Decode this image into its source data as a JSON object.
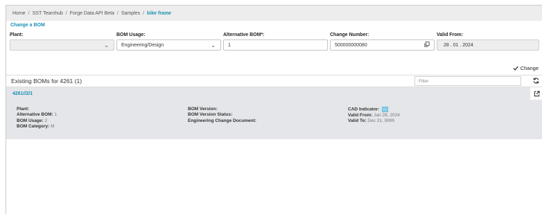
{
  "breadcrumb": {
    "items": [
      "Home",
      "SST Teamhub",
      "Forge Data API Beta",
      "Samples"
    ],
    "separator": "/",
    "current": "bike frame"
  },
  "form": {
    "heading": "Change a BOM",
    "plant": {
      "label": "Plant:",
      "value": ""
    },
    "bom_usage": {
      "label": "BOM Usage:",
      "value": "Engineering/Design"
    },
    "alternative_bom": {
      "label": "Alternative BOM*:",
      "value": "1"
    },
    "change_number": {
      "label": "Change Number:",
      "value": "500000000080"
    },
    "valid_from": {
      "label": "Valid From:",
      "value": "28 . 01 . 2024"
    }
  },
  "change_button": {
    "icon": "check-icon",
    "label": "Change"
  },
  "section": {
    "title": "Existing BOMs for 4261 (1)",
    "filter_placeholder": "Filter",
    "refresh_icon": "refresh-icon"
  },
  "bom_card": {
    "link": "4261//2/1",
    "open_icon": "open-external-icon",
    "col1": [
      {
        "label": "Plant:",
        "value": ""
      },
      {
        "label": "Alternative BOM:",
        "value": "1"
      },
      {
        "label": "BOM Usage:",
        "value": "2"
      },
      {
        "label": "BOM Category:",
        "value": "M"
      }
    ],
    "col2": [
      {
        "label": "BOM Version:",
        "value": ""
      },
      {
        "label": "BOM Version Status:",
        "value": ""
      },
      {
        "label": "Engineering Change Document:",
        "value": ""
      }
    ],
    "col3": [
      {
        "label": "CAD Indicator:",
        "value": ""
      },
      {
        "label": "Valid From:",
        "value": "Jan 28, 2024"
      },
      {
        "label": "Valid To:",
        "value": "Dec 31, 9999"
      }
    ]
  },
  "colors": {
    "accent": "#1b8fb5",
    "card_bg": "#e4e6e9",
    "breadcrumb_bg": "#ededed"
  }
}
